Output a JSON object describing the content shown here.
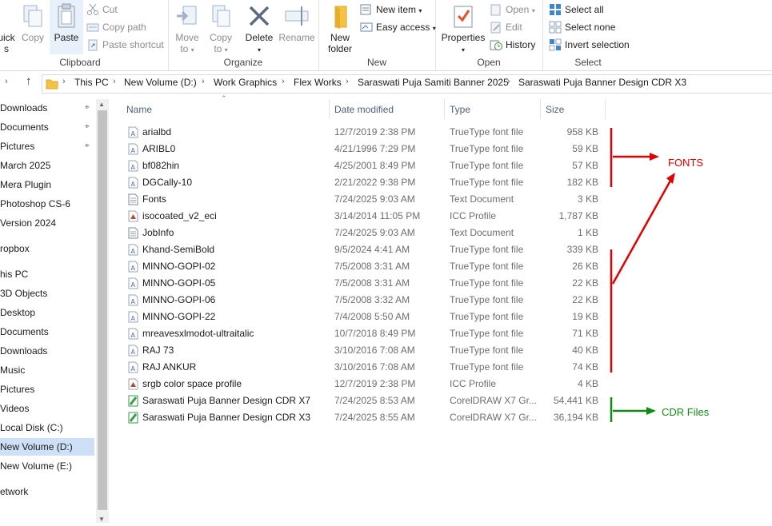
{
  "ribbon": {
    "clipboard": {
      "quick_access_partial": "uick",
      "quick_access_partial2": "s",
      "copy": "Copy",
      "paste": "Paste",
      "cut": "Cut",
      "copy_path": "Copy path",
      "paste_shortcut": "Paste shortcut",
      "label": "Clipboard"
    },
    "organize": {
      "move_to": "Move",
      "move_to_2": "to",
      "copy_to": "Copy",
      "copy_to_2": "to",
      "delete": "Delete",
      "rename": "Rename",
      "label": "Organize"
    },
    "new": {
      "new_folder": "New",
      "new_folder_2": "folder",
      "new_item": "New item",
      "easy_access": "Easy access",
      "label": "New"
    },
    "open": {
      "properties": "Properties",
      "open": "Open",
      "edit": "Edit",
      "history": "History",
      "label": "Open"
    },
    "select": {
      "select_all": "Select all",
      "select_none": "Select none",
      "invert_selection": "Invert selection",
      "label": "Select"
    }
  },
  "address": {
    "crumbs": [
      "This PC",
      "New Volume (D:)",
      "Work Graphics",
      "Flex Works",
      "Saraswati Puja Samiti Banner 2025",
      "Saraswati Puja Banner Design CDR X3"
    ]
  },
  "nav": {
    "items": [
      {
        "label": "Downloads",
        "pinned": true
      },
      {
        "label": "Documents",
        "pinned": true
      },
      {
        "label": "Pictures",
        "pinned": true
      },
      {
        "label": "March 2025"
      },
      {
        "label": "Mera Plugin"
      },
      {
        "label": "Photoshop CS-6"
      },
      {
        "label": "Version 2024"
      },
      {
        "label": "ropbox"
      },
      {
        "label": "his PC"
      },
      {
        "label": "3D Objects"
      },
      {
        "label": "Desktop"
      },
      {
        "label": "Documents"
      },
      {
        "label": "Downloads"
      },
      {
        "label": "Music"
      },
      {
        "label": "Pictures"
      },
      {
        "label": "Videos"
      },
      {
        "label": "Local Disk (C:)"
      },
      {
        "label": "New Volume (D:)",
        "selected": true
      },
      {
        "label": "New Volume (E:)"
      },
      {
        "label": "etwork"
      }
    ]
  },
  "columns": {
    "name": "Name",
    "date": "Date modified",
    "type": "Type",
    "size": "Size"
  },
  "files": [
    {
      "name": "arialbd",
      "date": "12/7/2019 2:38 PM",
      "type": "TrueType font file",
      "size": "958 KB",
      "icon": "font"
    },
    {
      "name": "ARIBL0",
      "date": "4/21/1996 7:29 PM",
      "type": "TrueType font file",
      "size": "59 KB",
      "icon": "font"
    },
    {
      "name": "bf082hin",
      "date": "4/25/2001 8:49 PM",
      "type": "TrueType font file",
      "size": "57 KB",
      "icon": "font"
    },
    {
      "name": "DGCally-10",
      "date": "2/21/2022 9:38 PM",
      "type": "TrueType font file",
      "size": "182 KB",
      "icon": "font"
    },
    {
      "name": "Fonts",
      "date": "7/24/2025 9:03 AM",
      "type": "Text Document",
      "size": "3 KB",
      "icon": "text"
    },
    {
      "name": "isocoated_v2_eci",
      "date": "3/14/2014 11:05 PM",
      "type": "ICC Profile",
      "size": "1,787 KB",
      "icon": "icc"
    },
    {
      "name": "JobInfo",
      "date": "7/24/2025 9:03 AM",
      "type": "Text Document",
      "size": "1 KB",
      "icon": "text"
    },
    {
      "name": "Khand-SemiBold",
      "date": "9/5/2024 4:41 AM",
      "type": "TrueType font file",
      "size": "339 KB",
      "icon": "font"
    },
    {
      "name": "MINNO-GOPI-02",
      "date": "7/5/2008 3:31 AM",
      "type": "TrueType font file",
      "size": "26 KB",
      "icon": "font"
    },
    {
      "name": "MINNO-GOPI-05",
      "date": "7/5/2008 3:31 AM",
      "type": "TrueType font file",
      "size": "22 KB",
      "icon": "font"
    },
    {
      "name": "MINNO-GOPI-06",
      "date": "7/5/2008 3:32 AM",
      "type": "TrueType font file",
      "size": "22 KB",
      "icon": "font"
    },
    {
      "name": "MINNO-GOPI-22",
      "date": "7/4/2008 5:50 AM",
      "type": "TrueType font file",
      "size": "19 KB",
      "icon": "font"
    },
    {
      "name": "mreavesxlmodot-ultraitalic",
      "date": "10/7/2018 8:49 PM",
      "type": "TrueType font file",
      "size": "71 KB",
      "icon": "font"
    },
    {
      "name": "RAJ 73",
      "date": "3/10/2016 7:08 AM",
      "type": "TrueType font file",
      "size": "40 KB",
      "icon": "font"
    },
    {
      "name": "RAJ ANKUR",
      "date": "3/10/2016 7:08 AM",
      "type": "TrueType font file",
      "size": "74 KB",
      "icon": "font"
    },
    {
      "name": "srgb color space profile",
      "date": "12/7/2019 2:38 PM",
      "type": "ICC Profile",
      "size": "4 KB",
      "icon": "icc"
    },
    {
      "name": "Saraswati Puja Banner Design CDR X7",
      "date": "7/24/2025 8:53 AM",
      "type": "CorelDRAW X7 Gr...",
      "size": "54,441 KB",
      "icon": "cdr"
    },
    {
      "name": "Saraswati Puja Banner Design CDR X3",
      "date": "7/24/2025 8:55 AM",
      "type": "CorelDRAW X7 Gr...",
      "size": "36,194 KB",
      "icon": "cdr"
    }
  ],
  "annotations": {
    "fonts_label": "FONTS",
    "cdr_label": "CDR Files",
    "fonts_color": "#e00000",
    "cdr_color": "#138a13"
  }
}
